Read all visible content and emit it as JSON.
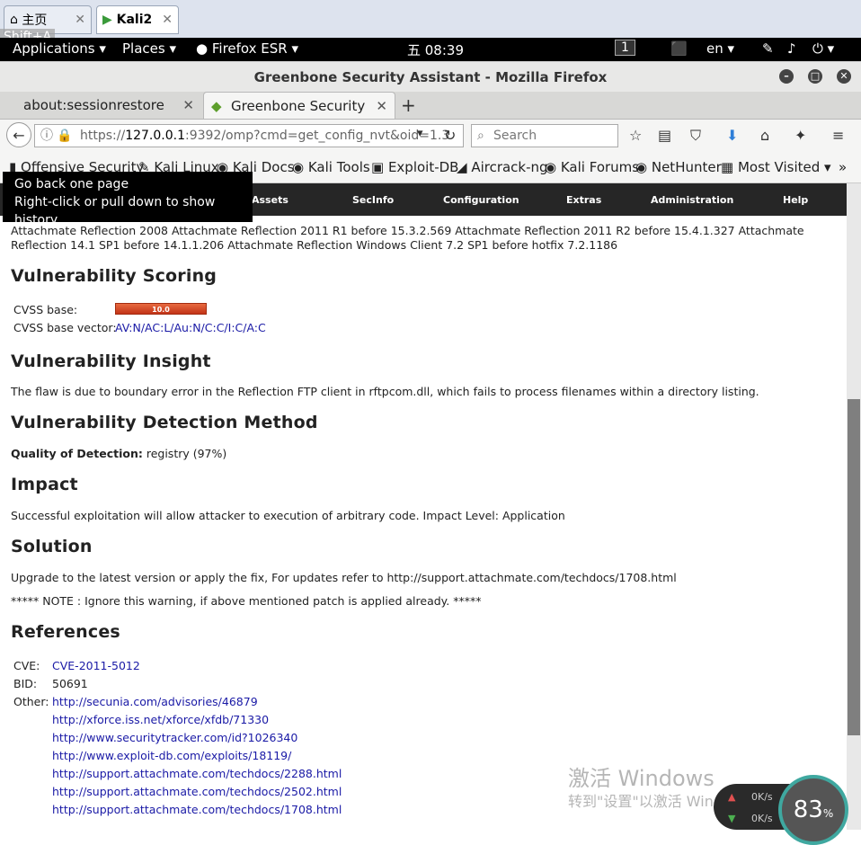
{
  "vm_tabs": [
    {
      "label": "主页",
      "icon": "home-icon"
    },
    {
      "label": "Kali2",
      "icon": "vm-icon"
    }
  ],
  "overlay_hint": "Shift+A",
  "panel": {
    "applications": "Applications",
    "places": "Places",
    "browser": "Firefox ESR",
    "clock": "五 08:39",
    "workspace": "1",
    "lang": "en"
  },
  "window_title": "Greenbone Security Assistant - Mozilla Firefox",
  "tabs": [
    {
      "label": "about:sessionrestore"
    },
    {
      "label": "Greenbone Security A..."
    }
  ],
  "url": {
    "prefix": "https://",
    "host": "127.0.0.1",
    "rest": ":9392/omp?cmd=get_config_nvt&oid=1.3"
  },
  "search_placeholder": "Search",
  "bookmarks": [
    "Offensive Security",
    "Kali Linux",
    "Kali Docs",
    "Kali Tools",
    "Exploit-DB",
    "Aircrack-ng",
    "Kali Forums",
    "NetHunter",
    "Most Visited"
  ],
  "tooltip": {
    "line1": "Go back one page",
    "line2": "Right-click or pull down to show history"
  },
  "gsa_menu": [
    "Assets",
    "SecInfo",
    "Configuration",
    "Extras",
    "Administration",
    "Help"
  ],
  "affected_text": "Attachmate Reflection 2008 Attachmate Reflection 2011 R1 before 15.3.2.569 Attachmate Reflection 2011 R2 before 15.4.1.327 Attachmate Reflection 14.1 SP1 before 14.1.1.206 Attachmate Reflection Windows Client 7.2 SP1 before hotfix 7.2.1186",
  "scoring": {
    "heading": "Vulnerability Scoring",
    "base_label": "CVSS base:",
    "base_value": "10.0",
    "vector_label": "CVSS base vector:",
    "vector_value": "AV:N/AC:L/Au:N/C:C/I:C/A:C"
  },
  "insight": {
    "heading": "Vulnerability Insight",
    "text": "The flaw is due to boundary error in the Reflection FTP client in rftpcom.dll, which fails to process filenames within a directory listing."
  },
  "detection": {
    "heading": "Vulnerability Detection Method",
    "label": "Quality of Detection:",
    "value": "registry (97%)"
  },
  "impact": {
    "heading": "Impact",
    "text": "Successful exploitation will allow attacker to execution of arbitrary code. Impact Level: Application"
  },
  "solution": {
    "heading": "Solution",
    "text": "Upgrade to the latest version or apply the fix, For updates refer to http://support.attachmate.com/techdocs/1708.html",
    "note": "***** NOTE : Ignore this warning, if above mentioned patch is applied already. *****"
  },
  "references": {
    "heading": "References",
    "cve_label": "CVE:",
    "cve": "CVE-2011-5012",
    "bid_label": "BID:",
    "bid": "50691",
    "other_label": "Other:",
    "links": [
      "http://secunia.com/advisories/46879",
      "http://xforce.iss.net/xforce/xfdb/71330",
      "http://www.securitytracker.com/id?1026340",
      "http://www.exploit-db.com/exploits/18119/",
      "http://support.attachmate.com/techdocs/2288.html",
      "http://support.attachmate.com/techdocs/2502.html",
      "http://support.attachmate.com/techdocs/1708.html"
    ]
  },
  "watermark": {
    "line1": "激活 Windows",
    "line2": "转到\"设置\"以激活 Windows。"
  },
  "net_widget": {
    "up": "0K/s",
    "down": "0K/s",
    "percent": "83",
    "percent_sign": "%"
  },
  "colors": {
    "cvss_bar": "#c23417",
    "link": "#1a1aa6",
    "menu_bg": "#262626"
  }
}
